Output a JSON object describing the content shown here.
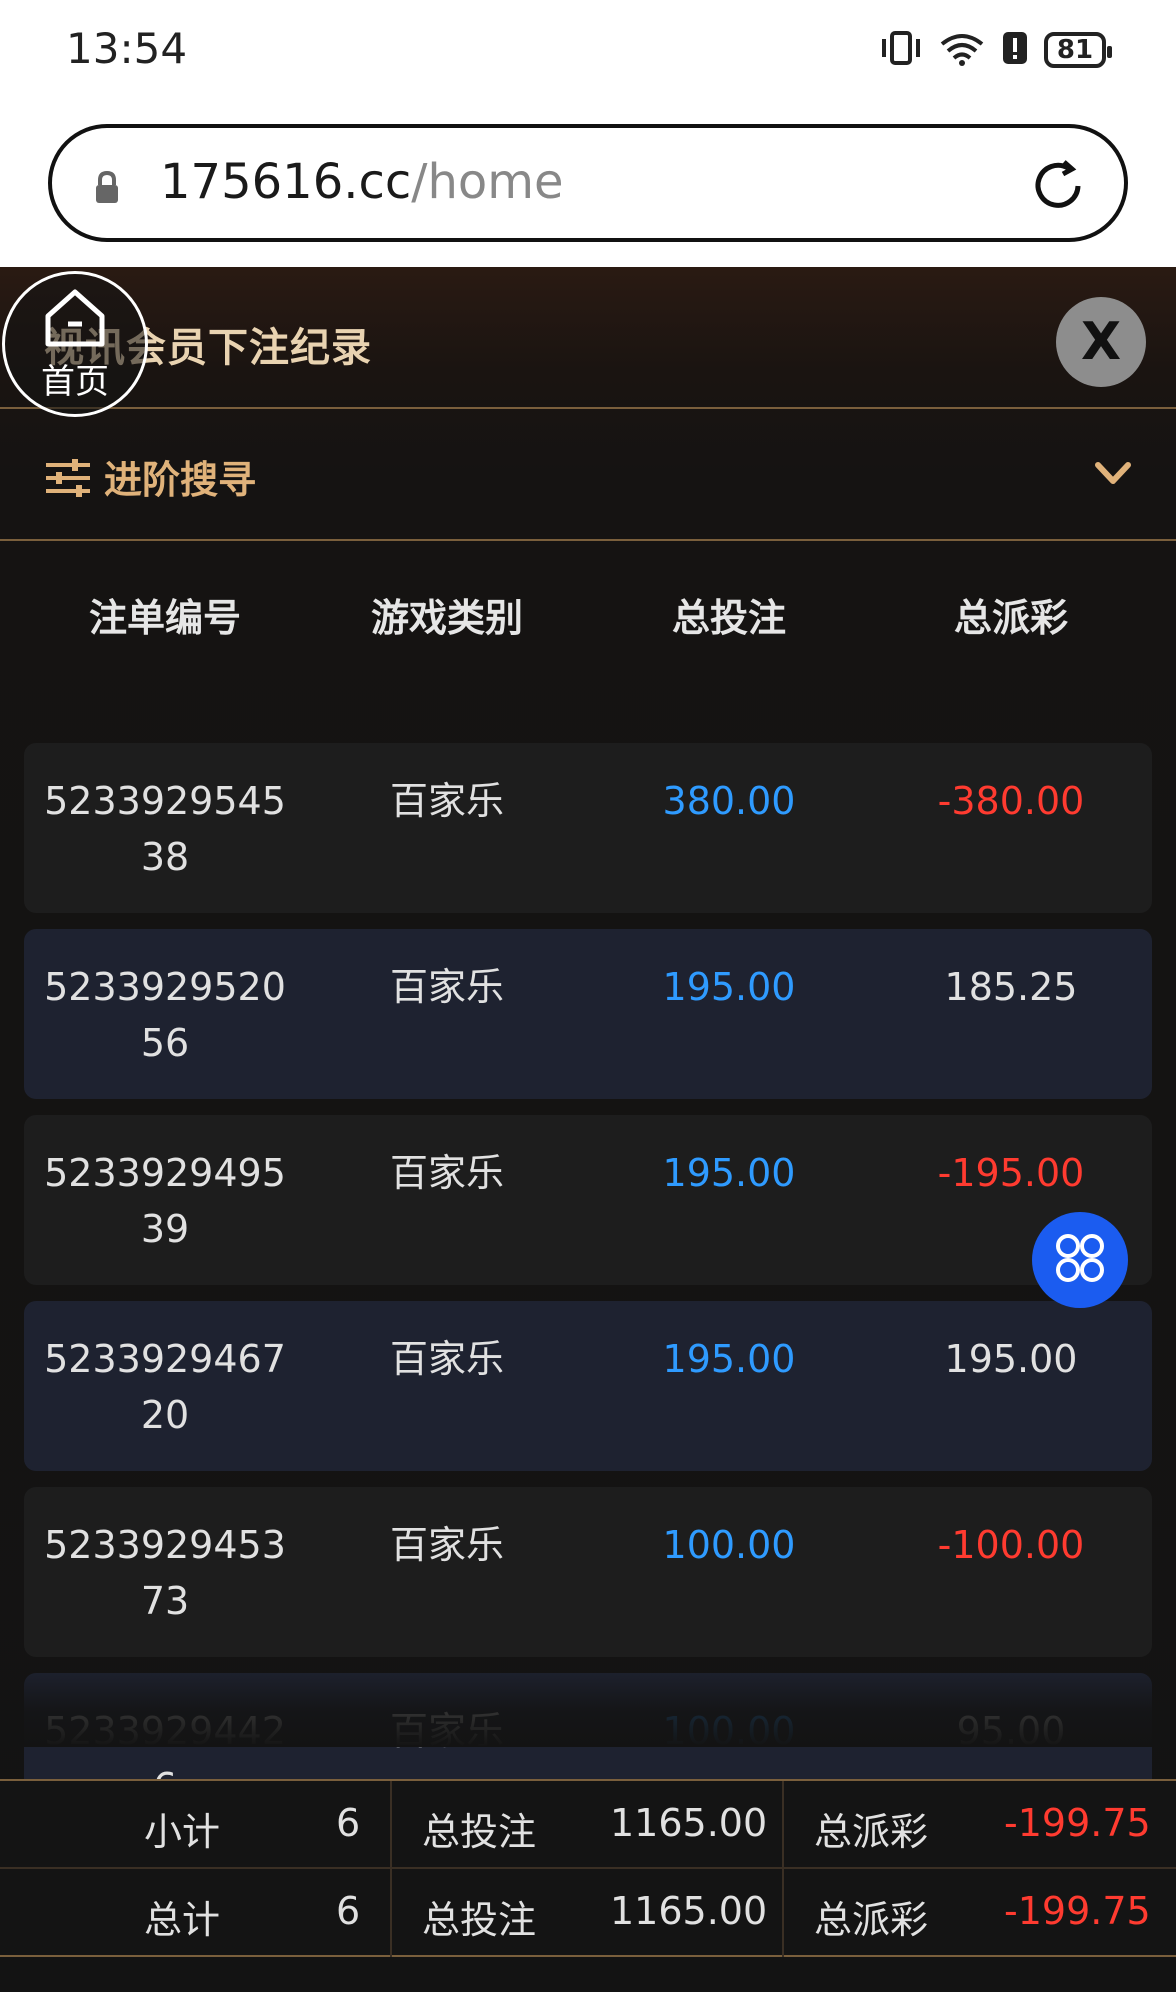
{
  "status_bar": {
    "time": "13:54",
    "battery": "81",
    "icons": [
      "vibrate-icon",
      "wifi-icon",
      "alert-icon",
      "battery-icon"
    ]
  },
  "browser": {
    "url_host": "175616.cc",
    "url_path": "/home",
    "icons": [
      "lock-icon",
      "reload-icon"
    ]
  },
  "header": {
    "home_label": "首页",
    "title": "视讯会员下注纪录",
    "close_label": "X"
  },
  "advanced_search": {
    "label": "进阶搜寻"
  },
  "columns": [
    "注单编号",
    "游戏类别",
    "总投注",
    "总派彩"
  ],
  "rows": [
    {
      "id": "523392954538",
      "game": "百家乐",
      "bet": "380.00",
      "payout": "-380.00"
    },
    {
      "id": "523392952056",
      "game": "百家乐",
      "bet": "195.00",
      "payout": "185.25"
    },
    {
      "id": "523392949539",
      "game": "百家乐",
      "bet": "195.00",
      "payout": "-195.00"
    },
    {
      "id": "523392946720",
      "game": "百家乐",
      "bet": "195.00",
      "payout": "195.00"
    },
    {
      "id": "523392945373",
      "game": "百家乐",
      "bet": "100.00",
      "payout": "-100.00"
    },
    {
      "id": "52339294426",
      "game": "百家乐",
      "bet": "100.00",
      "payout": "95.00"
    }
  ],
  "summary": {
    "subtotal": {
      "label": "小计",
      "count": "6",
      "bet_label": "总投注",
      "bet": "1165.00",
      "payout_label": "总派彩",
      "payout": "-199.75"
    },
    "total": {
      "label": "总计",
      "count": "6",
      "bet_label": "总投注",
      "bet": "1165.00",
      "payout_label": "总派彩",
      "payout": "-199.75"
    }
  },
  "colors": {
    "gold": "#e0b27a",
    "bet_blue": "#2f9bff",
    "loss_red": "#ff3b30",
    "float_button": "#1b5cf0"
  }
}
